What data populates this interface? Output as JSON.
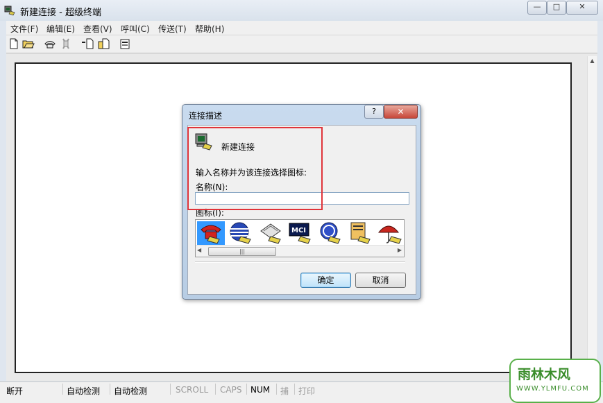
{
  "window": {
    "title": "新建连接 - 超级终端",
    "controls": {
      "minimize": "—",
      "maximize": "□",
      "close": "✕"
    }
  },
  "menu": [
    {
      "label": "文件(F)"
    },
    {
      "label": "编辑(E)"
    },
    {
      "label": "查看(V)"
    },
    {
      "label": "呼叫(C)"
    },
    {
      "label": "传送(T)"
    },
    {
      "label": "帮助(H)"
    }
  ],
  "toolbar": {
    "icons": [
      "new-file-icon",
      "open-folder-icon",
      "phone-call-icon",
      "disconnect-icon",
      "send-file-icon",
      "receive-file-icon",
      "properties-icon"
    ]
  },
  "status_bar": {
    "connection": "断开",
    "detect1": "自动检测",
    "detect2": "自动检测",
    "scroll": "SCROLL",
    "caps": "CAPS",
    "num": "NUM",
    "capture": "捕",
    "print": "打印"
  },
  "dialog": {
    "title": "连接描述",
    "help": "?",
    "connection_name": "新建连接",
    "prompt": "输入名称并为该连接选择图标:",
    "name_label": "名称(N):",
    "name_value": "",
    "icon_label": "图标(I):",
    "icons": [
      "red-telephone-icon",
      "globe-telephone-icon",
      "fax-telephone-icon",
      "mci-telephone-icon",
      "ge-telephone-icon",
      "document-telephone-icon",
      "umbrella-telephone-icon"
    ],
    "icons_selected_index": 0,
    "ok_label": "确定",
    "cancel_label": "取消"
  },
  "watermark": {
    "brand": "雨林木风",
    "url": "WWW.YLMFU.COM"
  },
  "colors": {
    "highlight_box": "#e0343a",
    "selected_icon_bg": "#3399ff",
    "watermark_green": "#3a8d2b"
  }
}
